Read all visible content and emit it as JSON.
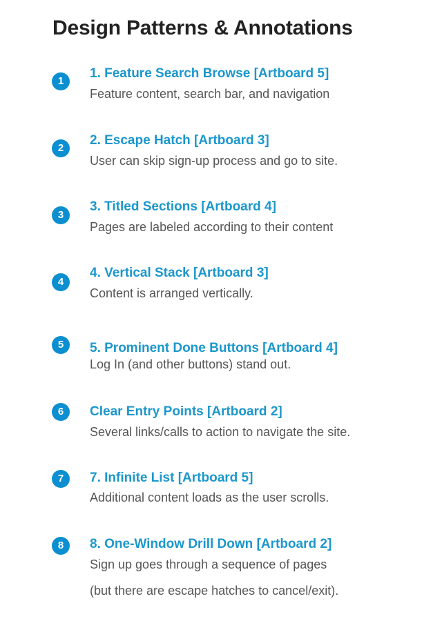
{
  "page": {
    "title": "Design Patterns & Annotations"
  },
  "colors": {
    "badge": "#0b8fd1",
    "item_title": "#1b97cc",
    "description": "#555555",
    "heading": "#222222"
  },
  "items": [
    {
      "badge": "1",
      "title": "1. Feature Search Browse [Artboard 5]",
      "description": "Feature content, search bar, and navigation"
    },
    {
      "badge": "2",
      "title": "2. Escape Hatch [Artboard 3]",
      "description": "User can skip sign-up process and go to site."
    },
    {
      "badge": "3",
      "title": "3. Titled Sections [Artboard 4]",
      "description": "Pages are labeled according to their content"
    },
    {
      "badge": "4",
      "title": "4. Vertical Stack [Artboard 3]",
      "description": "Content is arranged vertically."
    },
    {
      "badge": "5",
      "title": "5. Prominent Done Buttons [Artboard 4]",
      "description": "Log In (and other buttons) stand out."
    },
    {
      "badge": "6",
      "title": "Clear Entry Points [Artboard 2]",
      "description": "Several links/calls to action to navigate the site."
    },
    {
      "badge": "7",
      "title": "7. Infinite List [Artboard 5]",
      "description": "Additional content loads as the user scrolls."
    },
    {
      "badge": "8",
      "title": "8. One-Window Drill Down [Artboard 2]",
      "description": "Sign up goes through a sequence of pages",
      "description_line2": "(but there are escape hatches to cancel/exit)."
    }
  ]
}
